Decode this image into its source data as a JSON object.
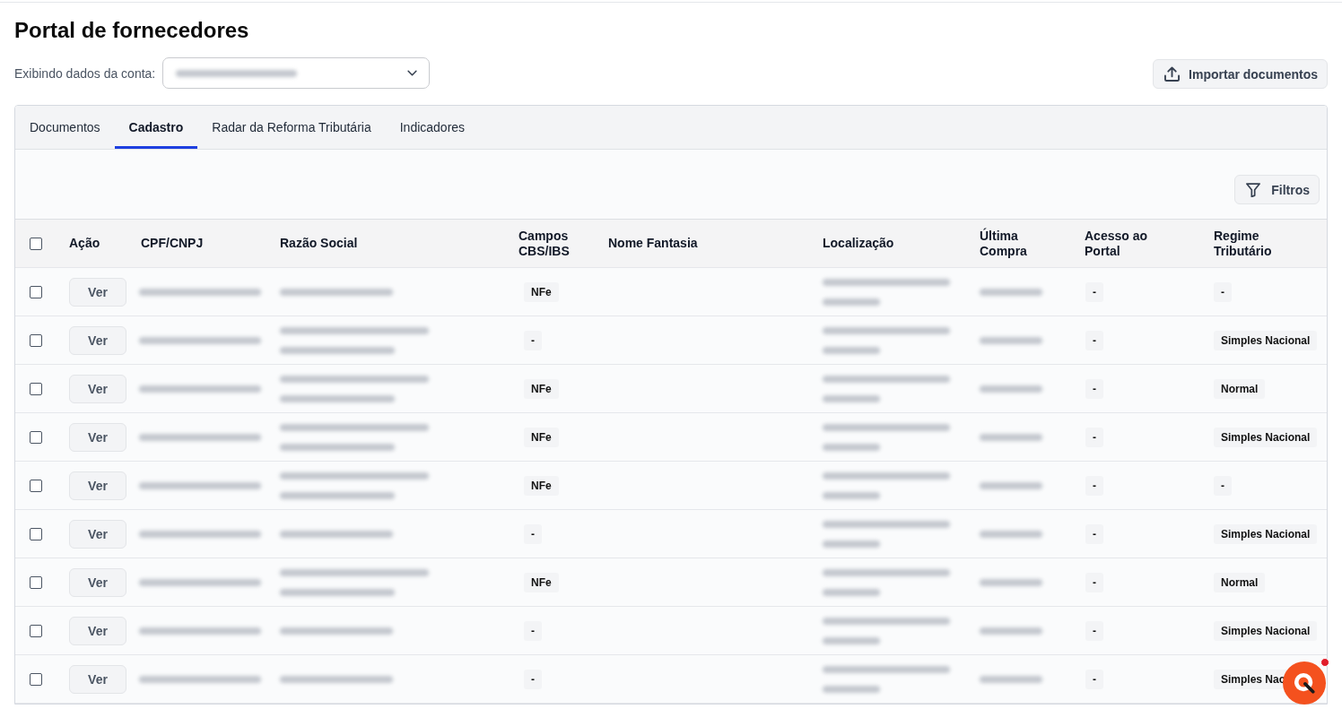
{
  "page": {
    "title": "Portal de fornecedores"
  },
  "account": {
    "label": "Exibindo dados da conta:"
  },
  "import_button": {
    "label": "Importar documentos"
  },
  "tabs": [
    {
      "label": "Documentos",
      "selected": false
    },
    {
      "label": "Cadastro",
      "selected": true
    },
    {
      "label": "Radar da Reforma Tributária",
      "selected": false
    },
    {
      "label": "Indicadores",
      "selected": false
    }
  ],
  "filter_button": {
    "label": "Filtros"
  },
  "table": {
    "all_selected": false,
    "columns": [
      "Ação",
      "CPF/CNPJ",
      "Razão Social",
      "Campos CBS/IBS",
      "Nome Fantasia",
      "Localização",
      "Última Compra",
      "Acesso ao Portal",
      "Regime Tributário"
    ],
    "rows": [
      {
        "kind": "single",
        "selected": false,
        "action": "Ver",
        "campos_cbs_ibs": "NFe",
        "acesso_portal": "-",
        "regime_tributario": "-"
      },
      {
        "kind": "double",
        "selected": false,
        "action": "Ver",
        "campos_cbs_ibs": "-",
        "acesso_portal": "-",
        "regime_tributario": "Simples Nacional"
      },
      {
        "kind": "double",
        "selected": false,
        "action": "Ver",
        "campos_cbs_ibs": "NFe",
        "acesso_portal": "-",
        "regime_tributario": "Normal"
      },
      {
        "kind": "double",
        "selected": false,
        "action": "Ver",
        "campos_cbs_ibs": "NFe",
        "acesso_portal": "-",
        "regime_tributario": "Simples Nacional"
      },
      {
        "kind": "double",
        "selected": false,
        "action": "Ver",
        "campos_cbs_ibs": "NFe",
        "acesso_portal": "-",
        "regime_tributario": "-"
      },
      {
        "kind": "single",
        "selected": false,
        "action": "Ver",
        "campos_cbs_ibs": "-",
        "acesso_portal": "-",
        "regime_tributario": "Simples Nacional"
      },
      {
        "kind": "double",
        "selected": false,
        "action": "Ver",
        "campos_cbs_ibs": "NFe",
        "acesso_portal": "-",
        "regime_tributario": "Normal"
      },
      {
        "kind": "single",
        "selected": false,
        "action": "Ver",
        "campos_cbs_ibs": "-",
        "acesso_portal": "-",
        "regime_tributario": "Simples Nacional"
      },
      {
        "kind": "single",
        "selected": false,
        "action": "Ver",
        "campos_cbs_ibs": "-",
        "acesso_portal": "-",
        "regime_tributario": "Simples Nac"
      }
    ]
  },
  "chat_button": {
    "notification": true
  }
}
